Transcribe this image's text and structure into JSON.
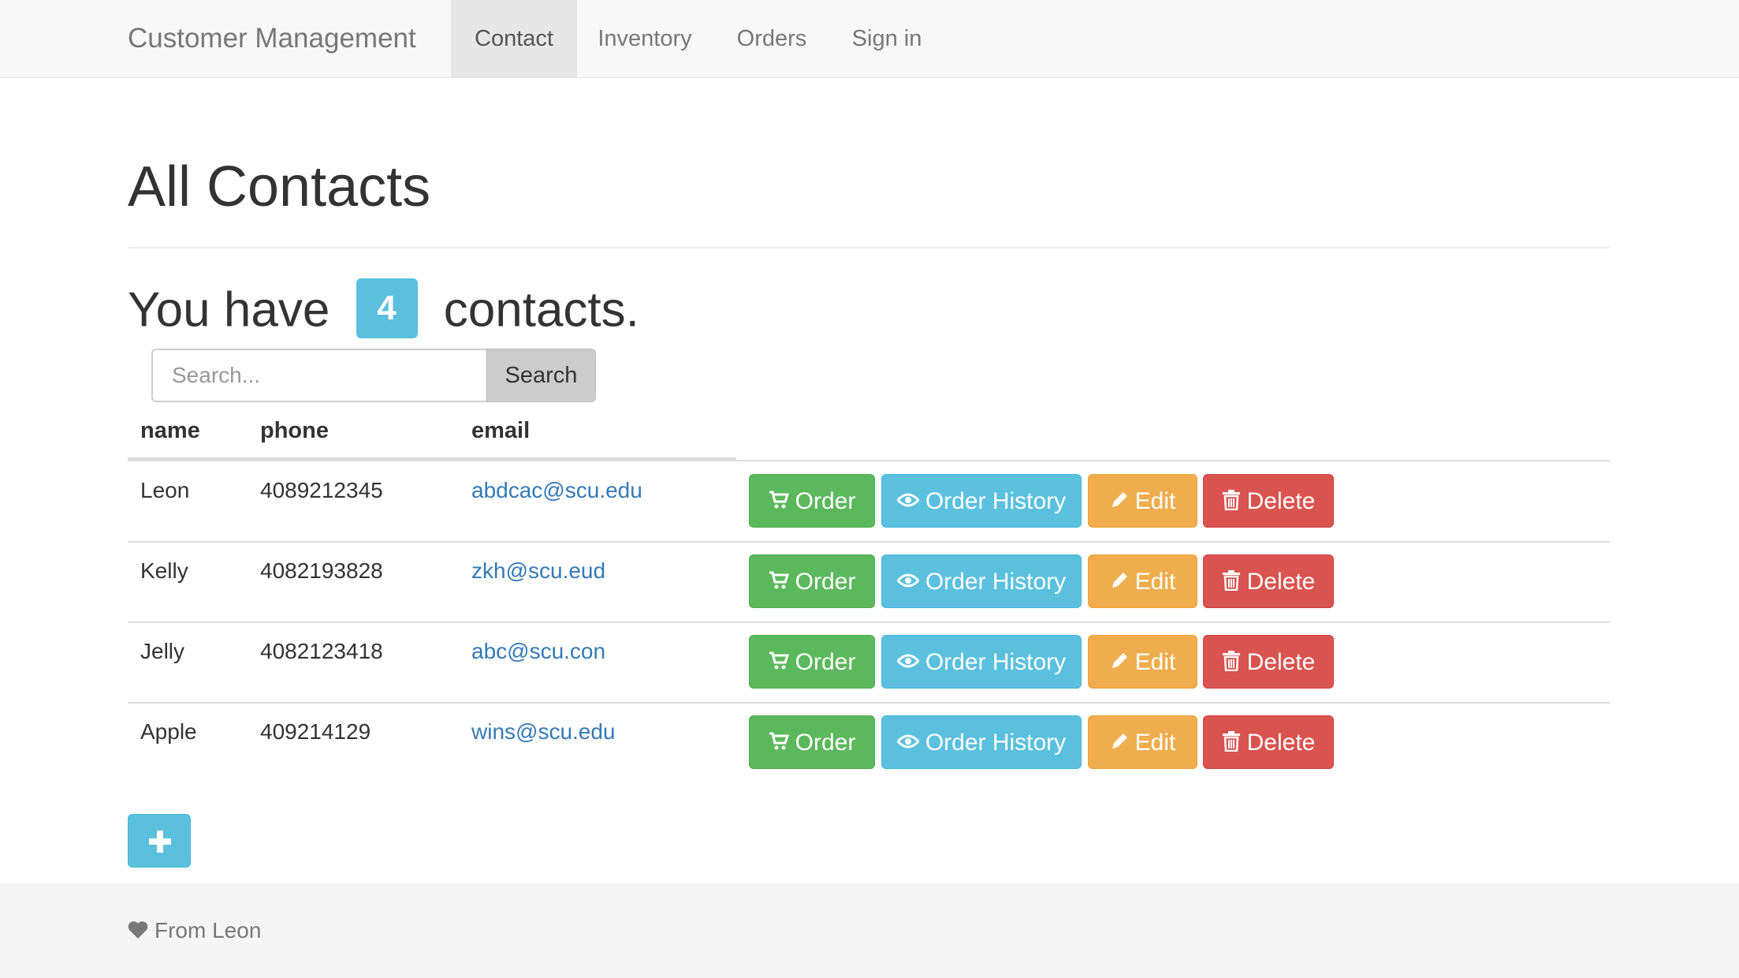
{
  "navbar": {
    "brand": "Customer Management",
    "items": [
      {
        "label": "Contact",
        "active": true
      },
      {
        "label": "Inventory",
        "active": false
      },
      {
        "label": "Orders",
        "active": false
      },
      {
        "label": "Sign in",
        "active": false
      }
    ]
  },
  "page": {
    "title": "All Contacts",
    "count_prefix": "You have",
    "count": "4",
    "count_suffix": "contacts."
  },
  "search": {
    "placeholder": "Search...",
    "button_label": "Search"
  },
  "table": {
    "headers": [
      "name",
      "phone",
      "email"
    ],
    "rows": [
      {
        "name": "Leon",
        "phone": "4089212345",
        "email": "abdcac@scu.edu"
      },
      {
        "name": "Kelly",
        "phone": "4082193828",
        "email": "zkh@scu.eud"
      },
      {
        "name": "Jelly",
        "phone": "4082123418",
        "email": "abc@scu.con"
      },
      {
        "name": "Apple",
        "phone": "409214129",
        "email": "wins@scu.edu"
      }
    ],
    "actions": {
      "order": "Order",
      "history": "Order History",
      "edit": "Edit",
      "delete": "Delete"
    }
  },
  "icons": {
    "order": "shopping-cart-icon",
    "history": "eye-icon",
    "edit": "pencil-icon",
    "delete": "trash-icon",
    "add": "plus-icon",
    "footer": "heart-icon"
  },
  "colors": {
    "success": "#5cb85c",
    "info": "#5bc0de",
    "warning": "#f0ad4e",
    "danger": "#d9534f",
    "link": "#337ab7"
  },
  "footer": {
    "text": "From Leon"
  }
}
